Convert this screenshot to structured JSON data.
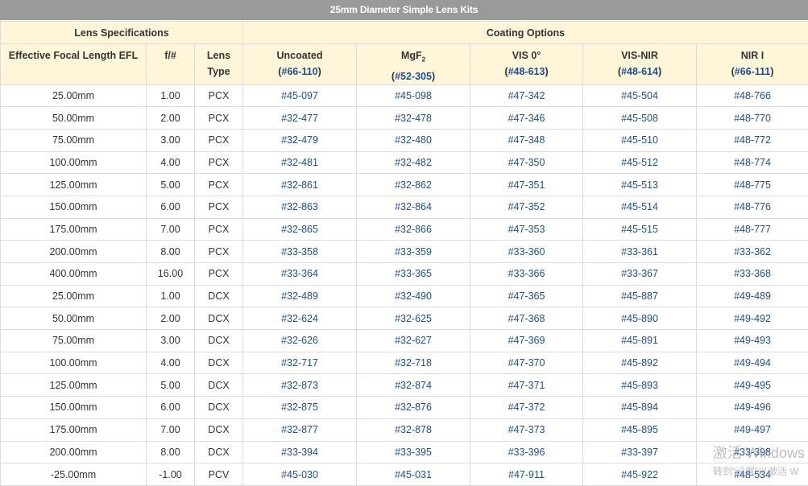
{
  "title": "25mm Diameter Simple Lens Kits",
  "groups": {
    "specs": "Lens Specifications",
    "coating": "Coating Options"
  },
  "columns": {
    "efl": "Effective Focal Length EFL",
    "fnum": "f/#",
    "lens_type_1": "Lens",
    "lens_type_2": "Type",
    "uncoated": {
      "name": "Uncoated",
      "code": "#66-110"
    },
    "mgf2": {
      "name_base": "MgF",
      "name_sub": "2",
      "code": "#52-305"
    },
    "vis0": {
      "name": "VIS 0°",
      "code": "#48-613"
    },
    "visnir": {
      "name": "VIS-NIR",
      "code": "#48-614"
    },
    "nir1": {
      "name": "NIR I",
      "code": "#66-111"
    }
  },
  "rows": [
    {
      "efl": "25.00mm",
      "f": "1.00",
      "type": "PCX",
      "c": [
        "#45-097",
        "#45-098",
        "#47-342",
        "#45-504",
        "#48-766"
      ]
    },
    {
      "efl": "50.00mm",
      "f": "2.00",
      "type": "PCX",
      "c": [
        "#32-477",
        "#32-478",
        "#47-346",
        "#45-508",
        "#48-770"
      ]
    },
    {
      "efl": "75.00mm",
      "f": "3.00",
      "type": "PCX",
      "c": [
        "#32-479",
        "#32-480",
        "#47-348",
        "#45-510",
        "#48-772"
      ]
    },
    {
      "efl": "100.00mm",
      "f": "4.00",
      "type": "PCX",
      "c": [
        "#32-481",
        "#32-482",
        "#47-350",
        "#45-512",
        "#48-774"
      ]
    },
    {
      "efl": "125.00mm",
      "f": "5.00",
      "type": "PCX",
      "c": [
        "#32-861",
        "#32-862",
        "#47-351",
        "#45-513",
        "#48-775"
      ]
    },
    {
      "efl": "150.00mm",
      "f": "6.00",
      "type": "PCX",
      "c": [
        "#32-863",
        "#32-864",
        "#47-352",
        "#45-514",
        "#48-776"
      ]
    },
    {
      "efl": "175.00mm",
      "f": "7.00",
      "type": "PCX",
      "c": [
        "#32-865",
        "#32-866",
        "#47-353",
        "#45-515",
        "#48-777"
      ]
    },
    {
      "efl": "200.00mm",
      "f": "8.00",
      "type": "PCX",
      "c": [
        "#33-358",
        "#33-359",
        "#33-360",
        "#33-361",
        "#33-362"
      ]
    },
    {
      "efl": "400.00mm",
      "f": "16.00",
      "type": "PCX",
      "c": [
        "#33-364",
        "#33-365",
        "#33-366",
        "#33-367",
        "#33-368"
      ]
    },
    {
      "efl": "25.00mm",
      "f": "1.00",
      "type": "DCX",
      "c": [
        "#32-489",
        "#32-490",
        "#47-365",
        "#45-887",
        "#49-489"
      ]
    },
    {
      "efl": "50.00mm",
      "f": "2.00",
      "type": "DCX",
      "c": [
        "#32-624",
        "#32-625",
        "#47-368",
        "#45-890",
        "#49-492"
      ]
    },
    {
      "efl": "75.00mm",
      "f": "3.00",
      "type": "DCX",
      "c": [
        "#32-626",
        "#32-627",
        "#47-369",
        "#45-891",
        "#49-493"
      ]
    },
    {
      "efl": "100.00mm",
      "f": "4.00",
      "type": "DCX",
      "c": [
        "#32-717",
        "#32-718",
        "#47-370",
        "#45-892",
        "#49-494"
      ]
    },
    {
      "efl": "125.00mm",
      "f": "5.00",
      "type": "DCX",
      "c": [
        "#32-873",
        "#32-874",
        "#47-371",
        "#45-893",
        "#49-495"
      ]
    },
    {
      "efl": "150.00mm",
      "f": "6.00",
      "type": "DCX",
      "c": [
        "#32-875",
        "#32-876",
        "#47-372",
        "#45-894",
        "#49-496"
      ]
    },
    {
      "efl": "175.00mm",
      "f": "7.00",
      "type": "DCX",
      "c": [
        "#32-877",
        "#32-878",
        "#47-373",
        "#45-895",
        "#49-497"
      ]
    },
    {
      "efl": "200.00mm",
      "f": "8.00",
      "type": "DCX",
      "c": [
        "#33-394",
        "#33-395",
        "#33-396",
        "#33-397",
        "#33-398"
      ]
    },
    {
      "efl": "-25.00mm",
      "f": "-1.00",
      "type": "PCV",
      "c": [
        "#45-030",
        "#45-031",
        "#47-911",
        "#45-922",
        "#48-534"
      ]
    }
  ],
  "watermark": {
    "line1": "激活 Windows",
    "line2": "转到“设置”以激活 W"
  }
}
